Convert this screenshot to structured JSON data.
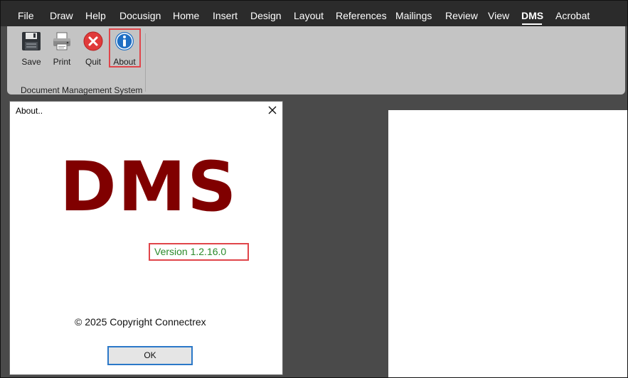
{
  "menu": {
    "items": [
      "File",
      "Draw",
      "Help",
      "Docusign",
      "Home",
      "Insert",
      "Design",
      "Layout",
      "References",
      "Mailings",
      "Review",
      "View",
      "DMS",
      "Acrobat"
    ],
    "active": "DMS"
  },
  "ribbon": {
    "buttons": [
      {
        "label": "Save",
        "icon": "floppy-disk-icon"
      },
      {
        "label": "Print",
        "icon": "printer-icon"
      },
      {
        "label": "Quit",
        "icon": "red-x-circle-icon"
      },
      {
        "label": "About",
        "icon": "info-circle-icon"
      }
    ],
    "group_label": "Document Management System"
  },
  "dialog": {
    "title": "About..",
    "logo_text": "DMS",
    "version": "Version  1.2.16.0",
    "copyright": "© 2025 Copyright Connectrex",
    "ok_label": "OK"
  },
  "colors": {
    "logo": "#800000",
    "version": "#2a8a2a",
    "highlight": "#e0454a",
    "ok_border": "#2b78c8",
    "menubar_bg": "#2b2b2b",
    "ribbon_bg": "#c4c4c4"
  }
}
